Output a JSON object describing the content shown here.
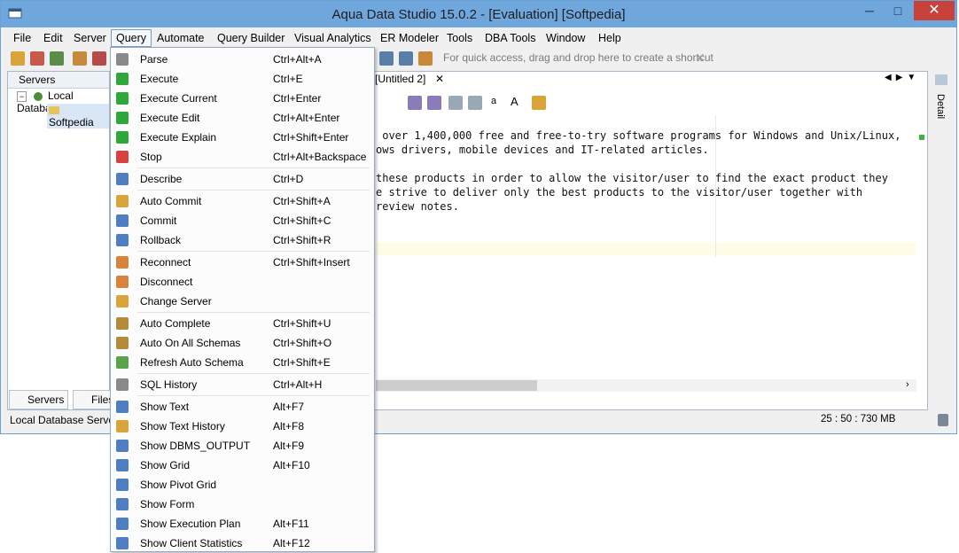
{
  "window": {
    "title": "Aqua Data Studio 15.0.2 - [Evaluation] [Softpedia]",
    "minimize": "─",
    "maximize": "□",
    "close": "✕"
  },
  "menubar": {
    "items": [
      {
        "label": "File"
      },
      {
        "label": "Edit"
      },
      {
        "label": "Server"
      },
      {
        "label": "Query"
      },
      {
        "label": "Automate"
      },
      {
        "label": "Query Builder"
      },
      {
        "label": "Visual Analytics"
      },
      {
        "label": "ER Modeler"
      },
      {
        "label": "Tools"
      },
      {
        "label": "DBA Tools"
      },
      {
        "label": "Window"
      },
      {
        "label": "Help"
      }
    ],
    "active_index": 3
  },
  "toolbar": {
    "quick_access_hint": "For quick access, drag and drop here to create a shortcut",
    "close_hint": "✕"
  },
  "servers_panel": {
    "header": "Servers",
    "tree": [
      {
        "label": "Local Database",
        "level": 0
      },
      {
        "label": "Softpedia",
        "level": 1
      }
    ],
    "tabs": [
      {
        "label": "Servers"
      },
      {
        "label": "Files"
      }
    ]
  },
  "editor": {
    "tab_prefix": "r",
    "tab_label": "[Untitled 2]",
    "tab_close": "✕",
    "lines": [
      " over 1,400,000 free and free-to-try software programs for Windows and Unix/Linux,",
      "ows drivers, mobile devices and IT-related articles.",
      "",
      "these products in order to allow the visitor/user to find the exact product they",
      "e strive to deliver only the best products to the visitor/user together with",
      "review notes."
    ],
    "font_up": "a",
    "font_down": "A",
    "detail_label": "Detail"
  },
  "statusbar": {
    "left": "Local Database Servers",
    "memory": "25 : 50 : 730 MB"
  },
  "query_menu": {
    "items": [
      {
        "label": "Parse",
        "shortcut": "Ctrl+Alt+A",
        "icon": "parse-icon",
        "color": "#8a8a8a"
      },
      {
        "label": "Execute",
        "shortcut": "Ctrl+E",
        "icon": "execute-icon",
        "color": "#2fa83a"
      },
      {
        "label": "Execute Current",
        "shortcut": "Ctrl+Enter",
        "icon": "execute-current-icon",
        "color": "#2fa83a"
      },
      {
        "label": "Execute Edit",
        "shortcut": "Ctrl+Alt+Enter",
        "icon": "execute-edit-icon",
        "color": "#2fa83a"
      },
      {
        "label": "Execute Explain",
        "shortcut": "Ctrl+Shift+Enter",
        "icon": "execute-explain-icon",
        "color": "#2fa83a"
      },
      {
        "label": "Stop",
        "shortcut": "Ctrl+Alt+Backspace",
        "icon": "stop-icon",
        "color": "#d94040"
      },
      {
        "label": "Describe",
        "shortcut": "Ctrl+D",
        "icon": "describe-icon",
        "color": "#4d7fc2"
      },
      {
        "label": "Auto Commit",
        "shortcut": "Ctrl+Shift+A",
        "icon": "auto-commit-icon",
        "color": "#d9a53a"
      },
      {
        "label": "Commit",
        "shortcut": "Ctrl+Shift+C",
        "icon": "commit-icon",
        "color": "#4d7fc2"
      },
      {
        "label": "Rollback",
        "shortcut": "Ctrl+Shift+R",
        "icon": "rollback-icon",
        "color": "#4d7fc2"
      },
      {
        "label": "Reconnect",
        "shortcut": "Ctrl+Shift+Insert",
        "icon": "reconnect-icon",
        "color": "#d9833a"
      },
      {
        "label": "Disconnect",
        "shortcut": "",
        "icon": "disconnect-icon",
        "color": "#d9833a"
      },
      {
        "label": "Change Server",
        "shortcut": "",
        "icon": "change-server-icon",
        "color": "#d9a53a"
      },
      {
        "label": "Auto Complete",
        "shortcut": "Ctrl+Shift+U",
        "icon": "auto-complete-icon",
        "color": "#b58a3a"
      },
      {
        "label": "Auto On All Schemas",
        "shortcut": "Ctrl+Shift+O",
        "icon": "auto-schemas-icon",
        "color": "#b58a3a"
      },
      {
        "label": "Refresh Auto Schema",
        "shortcut": "Ctrl+Shift+E",
        "icon": "refresh-schema-icon",
        "color": "#5aa34a"
      },
      {
        "label": "SQL History",
        "shortcut": "Ctrl+Alt+H",
        "icon": "sql-history-icon",
        "color": "#8a8a8a"
      },
      {
        "label": "Show Text",
        "shortcut": "Alt+F7",
        "icon": "show-text-icon",
        "color": "#4d7fc2"
      },
      {
        "label": "Show Text History",
        "shortcut": "Alt+F8",
        "icon": "show-text-history-icon",
        "color": "#d9a53a"
      },
      {
        "label": "Show DBMS_OUTPUT",
        "shortcut": "Alt+F9",
        "icon": "dbms-output-icon",
        "color": "#4d7fc2"
      },
      {
        "label": "Show Grid",
        "shortcut": "Alt+F10",
        "icon": "grid-icon",
        "color": "#4d7fc2"
      },
      {
        "label": "Show Pivot Grid",
        "shortcut": "",
        "icon": "pivot-grid-icon",
        "color": "#4d7fc2"
      },
      {
        "label": "Show Form",
        "shortcut": "",
        "icon": "form-icon",
        "color": "#4d7fc2"
      },
      {
        "label": "Show Execution Plan",
        "shortcut": "Alt+F11",
        "icon": "execution-plan-icon",
        "color": "#4d7fc2"
      },
      {
        "label": "Show Client Statistics",
        "shortcut": "Alt+F12",
        "icon": "client-statistics-icon",
        "color": "#4d7fc2"
      }
    ]
  }
}
